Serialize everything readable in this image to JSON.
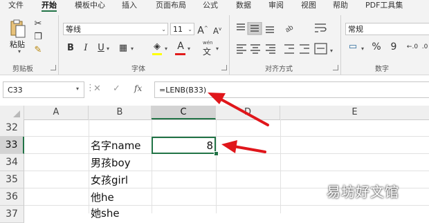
{
  "ribbon_tabs": [
    "文件",
    "开始",
    "模板中心",
    "插入",
    "页面布局",
    "公式",
    "数据",
    "审阅",
    "视图",
    "帮助",
    "PDF工具集"
  ],
  "active_tab": "开始",
  "clipboard": {
    "paste_label": "粘贴",
    "group_label": "剪贴板"
  },
  "font": {
    "name": "等线",
    "size": "11",
    "group_label": "字体",
    "bold": "B",
    "italic": "I",
    "underline": "U",
    "increase_size": "A",
    "decrease_size": "A",
    "font_color_letter": "A",
    "phonetic_top": "wén",
    "phonetic_bottom": "文"
  },
  "alignment": {
    "group_label": "对齐方式"
  },
  "number": {
    "format": "常规",
    "group_label": "数字",
    "percent": "%",
    "comma": "9"
  },
  "formula_bar": {
    "name_box": "C33",
    "formula": "=LENB(B33)",
    "fx": "fx"
  },
  "grid": {
    "columns": [
      "A",
      "B",
      "C",
      "D",
      "E"
    ],
    "selected_column": "C",
    "rows": [
      "32",
      "33",
      "34",
      "35",
      "36",
      "37"
    ],
    "selected_row": "33",
    "cells": [
      {
        "row": "33",
        "col": "B",
        "value": "名字name"
      },
      {
        "row": "33",
        "col": "C",
        "value": "8"
      },
      {
        "row": "34",
        "col": "B",
        "value": "男孩boy"
      },
      {
        "row": "35",
        "col": "B",
        "value": "女孩girl"
      },
      {
        "row": "36",
        "col": "B",
        "value": "他he"
      },
      {
        "row": "37",
        "col": "B",
        "value": "她she"
      }
    ]
  },
  "watermark": "易坊好文馆",
  "colors": {
    "accent": "#217346",
    "arrow": "#e0161b",
    "font_color_bar": "#e11b1b"
  }
}
